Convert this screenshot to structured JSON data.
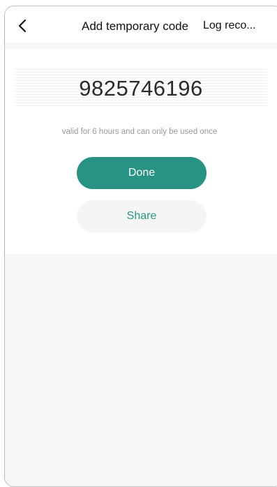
{
  "header": {
    "back_icon": "chevron-left-icon",
    "title": "Add temporary code",
    "log_link": "Log reco..."
  },
  "code_card": {
    "code": "9825746196",
    "hint": "valid for 6 hours and can only be used once",
    "done_label": "Done",
    "share_label": "Share"
  },
  "colors": {
    "accent": "#289383",
    "share_text": "#279683",
    "background": "#f7f7f7"
  }
}
